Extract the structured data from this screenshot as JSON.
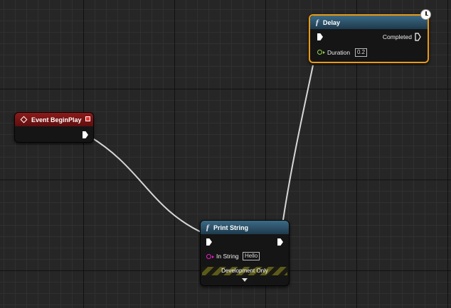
{
  "nodes": {
    "event_begin_play": {
      "title": "Event BeginPlay",
      "icon": "event-diamond-icon",
      "header_color": "#8d1a1a"
    },
    "delay": {
      "title": "Delay",
      "icon": "function-icon",
      "header_color": "#3c6a85",
      "output_label": "Completed",
      "input_label": "Duration",
      "input_value": "0.2",
      "badge_icon": "clock-icon",
      "selected_border": "#e89a14"
    },
    "print_string": {
      "title": "Print String",
      "icon": "function-icon",
      "header_color": "#3c6a85",
      "input_label": "In String",
      "input_value": "Hello",
      "dev_label": "Development Only",
      "expand_icon": "expand-arrow-icon"
    }
  },
  "colors": {
    "wire": "#d6d6d6",
    "float_pin": "#9bd64a",
    "string_pin": "#e620c8",
    "graph_bg": "#262626"
  }
}
